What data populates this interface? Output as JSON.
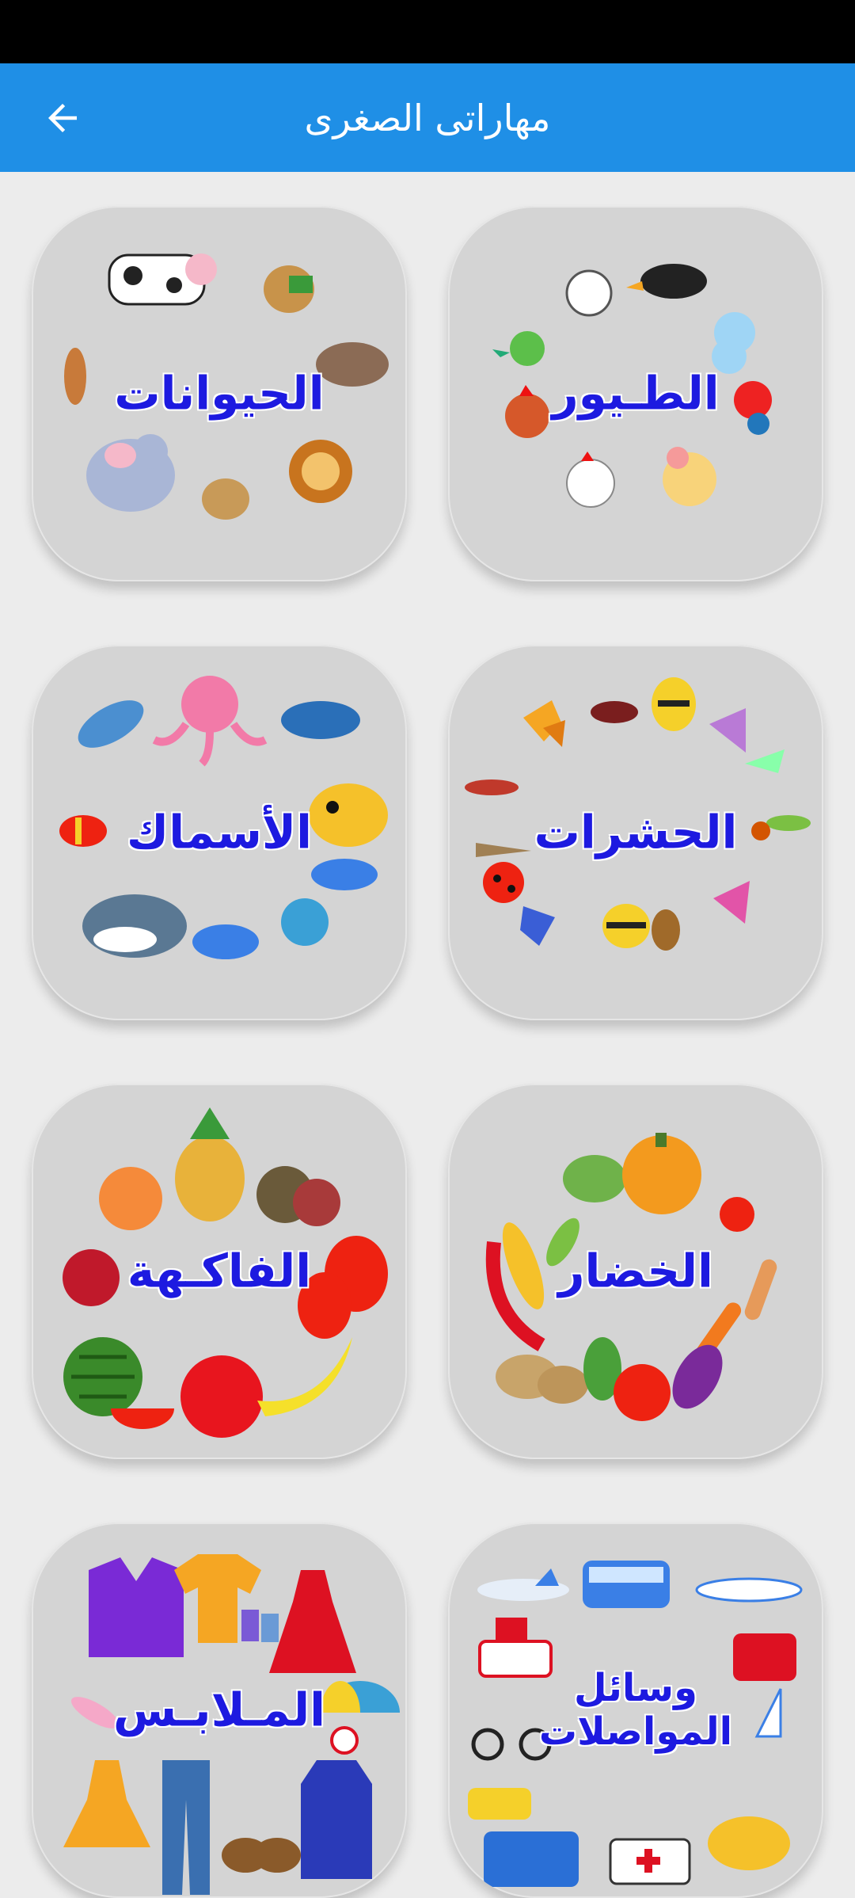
{
  "app_bar": {
    "title": "مهاراتى الصغرى",
    "back_icon": "arrow-left-icon"
  },
  "colors": {
    "app_bar": "#1f8fe6",
    "card": "#d4d4d4",
    "label": "#1d1ae0",
    "background": "#ececec"
  },
  "categories": [
    {
      "label": "الطـيور",
      "icon": "birds"
    },
    {
      "label": "الحيوانات",
      "icon": "animals"
    },
    {
      "label": "الحشرات",
      "icon": "insects"
    },
    {
      "label": "الأسماك",
      "icon": "fish"
    },
    {
      "label": "الخضار",
      "icon": "vegetables"
    },
    {
      "label": "الفاكـهة",
      "icon": "fruits"
    },
    {
      "label": "وسائل المواصلات",
      "icon": "transport"
    },
    {
      "label": "المـلابـس",
      "icon": "clothes"
    }
  ]
}
